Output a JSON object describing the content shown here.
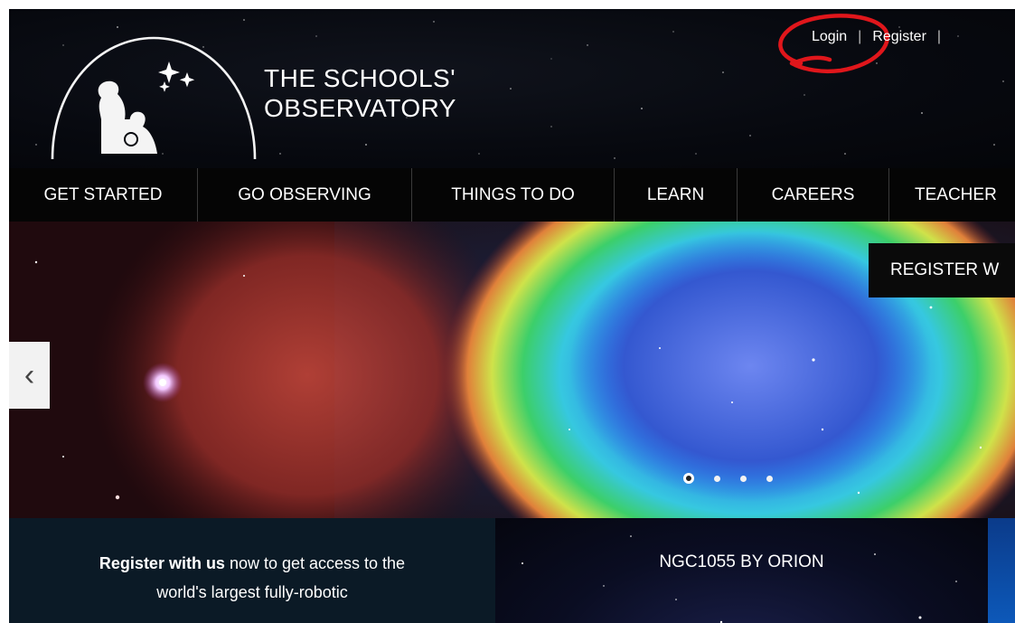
{
  "header": {
    "site_title_line1": "THE SCHOOLS'",
    "site_title_line2": "OBSERVATORY",
    "logo_icon": "observatory-dome-family-logo",
    "top_links": {
      "login": "Login",
      "register": "Register",
      "separator": "|"
    },
    "annotation_color": "#e0161b"
  },
  "nav": {
    "items": [
      {
        "label": "GET STARTED"
      },
      {
        "label": "GO OBSERVING"
      },
      {
        "label": "THINGS TO DO"
      },
      {
        "label": "LEARN"
      },
      {
        "label": "CAREERS"
      },
      {
        "label": "TEACHER"
      }
    ]
  },
  "hero": {
    "banner_label": "REGISTER W",
    "prev_arrow": "‹",
    "slide_count": 4,
    "active_slide": 1
  },
  "panels": {
    "register_bold": "Register with us",
    "register_text": " now to get access to the",
    "register_text2": "world's largest fully-robotic",
    "feature_title": "NGC1055 BY ORION"
  }
}
